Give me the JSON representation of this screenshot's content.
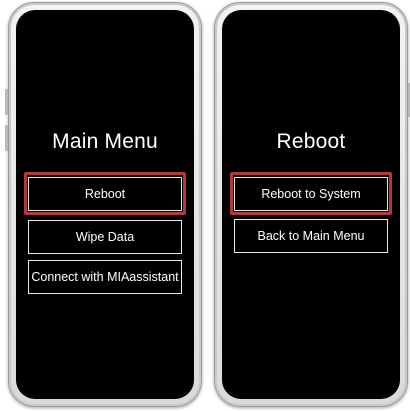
{
  "accent_color": "#b33a3a",
  "left_phone": {
    "title": "Main Menu",
    "buttons": [
      {
        "label": "Reboot",
        "highlighted": true
      },
      {
        "label": "Wipe Data",
        "highlighted": false
      },
      {
        "label": "Connect with MIAassistant",
        "highlighted": false
      }
    ]
  },
  "right_phone": {
    "title": "Reboot",
    "buttons": [
      {
        "label": "Reboot to System",
        "highlighted": true
      },
      {
        "label": "Back to Main Menu",
        "highlighted": false
      }
    ]
  }
}
